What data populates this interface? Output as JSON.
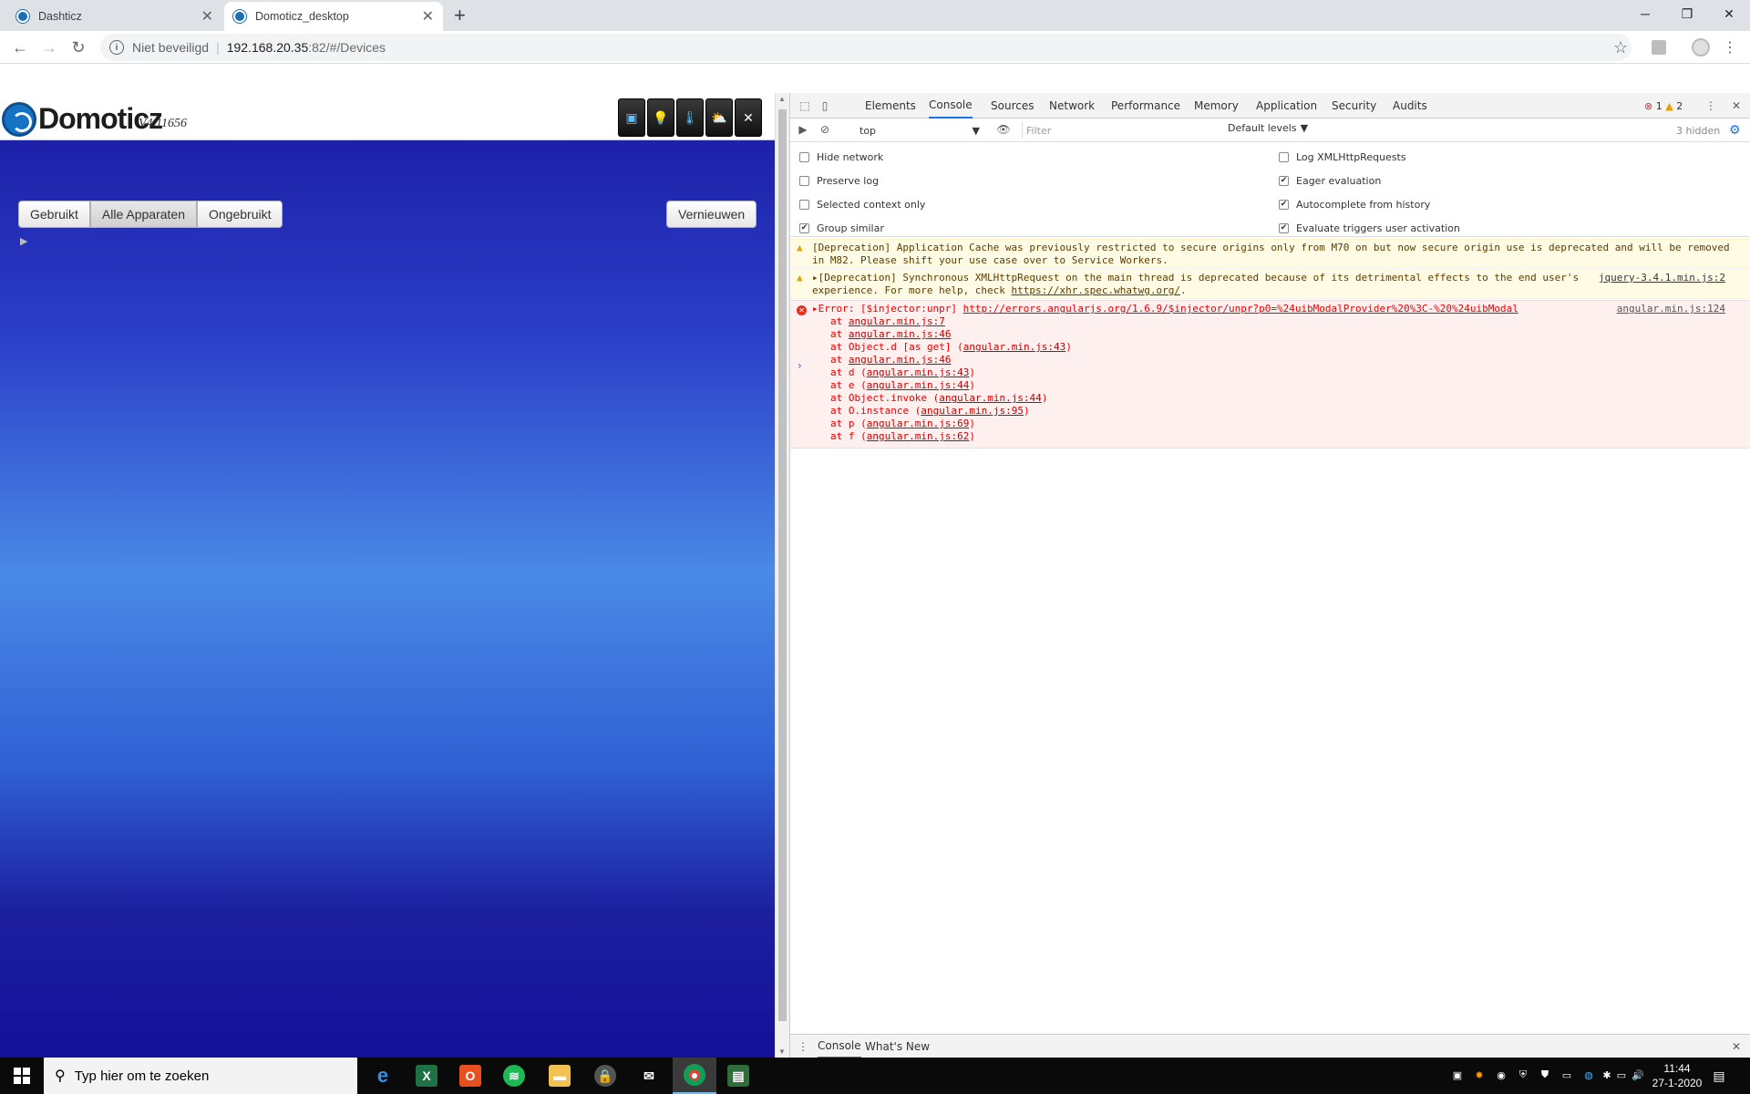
{
  "browser": {
    "tabs": [
      {
        "title": "Dashticz",
        "active": false
      },
      {
        "title": "Domoticz_desktop",
        "active": true
      }
    ],
    "address": {
      "security_label": "Niet beveiligd",
      "host": "192.168.20.35",
      "path": ":82/#/Devices"
    }
  },
  "domoticz": {
    "brand": "Domoticz",
    "version": "V4.11656",
    "filter_buttons": [
      "Gebruikt",
      "Alle Apparaten",
      "Ongebruikt"
    ],
    "active_filter": "Alle Apparaten",
    "refresh_label": "Vernieuwen"
  },
  "devtools": {
    "tabs": [
      "Elements",
      "Console",
      "Sources",
      "Network",
      "Performance",
      "Memory",
      "Application",
      "Security",
      "Audits"
    ],
    "active_tab": "Console",
    "error_count": "1",
    "warning_count": "2",
    "context": "top",
    "filter_placeholder": "Filter",
    "levels": "Default levels",
    "hidden": "3 hidden",
    "settings_left": [
      {
        "label": "Hide network",
        "checked": false
      },
      {
        "label": "Preserve log",
        "checked": false
      },
      {
        "label": "Selected context only",
        "checked": false
      },
      {
        "label": "Group similar",
        "checked": true
      }
    ],
    "settings_right": [
      {
        "label": "Log XMLHttpRequests",
        "checked": false
      },
      {
        "label": "Eager evaluation",
        "checked": true
      },
      {
        "label": "Autocomplete from history",
        "checked": true
      },
      {
        "label": "Evaluate triggers user activation",
        "checked": true
      }
    ],
    "messages": {
      "warn1": {
        "line1": "[Deprecation] Application Cache was previously restricted to secure origins only from M70 on but now secure origin use is deprecated and will be removed",
        "line2": "in M82.  Please shift your use case over to Service Workers."
      },
      "warn2": {
        "line1": "[Deprecation] Synchronous XMLHttpRequest on the main thread is deprecated because of its detrimental effects to the end user's",
        "line2_prefix": "experience. For more help, check ",
        "line2_link": "https://xhr.spec.whatwg.org/",
        "line2_suffix": ".",
        "source": "jquery-3.4.1.min.js:2"
      },
      "error": {
        "prefix": "Error: [$injector:unpr] ",
        "link": "http://errors.angularjs.org/1.6.9/$injector/unpr?p0=%24uibModalProvider%20%3C-%20%24uibModal",
        "source": "angular.min.js:124",
        "stack": [
          {
            "pre": "at ",
            "name": "",
            "link": "angular.min.js:7"
          },
          {
            "pre": "at ",
            "name": "",
            "link": "angular.min.js:46"
          },
          {
            "pre": "at ",
            "name": "Object.d [as get] (",
            "link": "angular.min.js:43"
          },
          {
            "pre": "at ",
            "name": "",
            "link": "angular.min.js:46"
          },
          {
            "pre": "at ",
            "name": "d (",
            "link": "angular.min.js:43"
          },
          {
            "pre": "at ",
            "name": "e (",
            "link": "angular.min.js:44"
          },
          {
            "pre": "at ",
            "name": "Object.invoke (",
            "link": "angular.min.js:44"
          },
          {
            "pre": "at ",
            "name": "O.instance (",
            "link": "angular.min.js:95"
          },
          {
            "pre": "at ",
            "name": "p (",
            "link": "angular.min.js:69"
          },
          {
            "pre": "at ",
            "name": "f (",
            "link": "angular.min.js:62"
          }
        ]
      }
    },
    "drawer_tabs": [
      "Console",
      "What's New"
    ]
  },
  "taskbar": {
    "search_placeholder": "Typ hier om te zoeken",
    "time": "11:44",
    "date": "27-1-2020"
  }
}
